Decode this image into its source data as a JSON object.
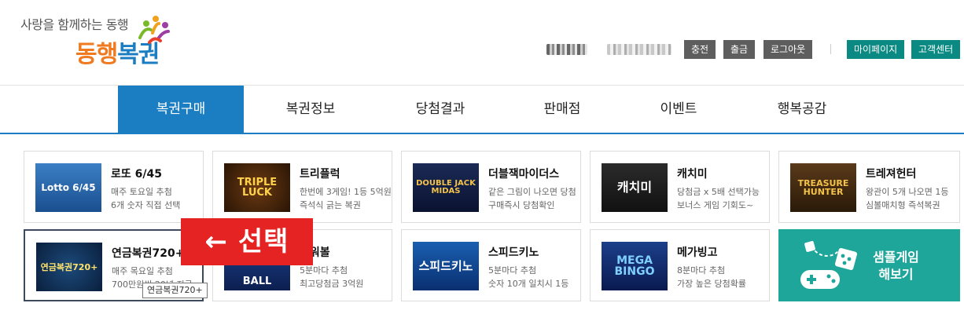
{
  "header": {
    "tagline": "사랑을 함께하는 동행",
    "logo_orange": "동행",
    "logo_blue": "복권",
    "buttons": {
      "charge": "충전",
      "withdraw": "출금",
      "logout": "로그아웃",
      "mypage": "마이페이지",
      "support": "고객센터"
    }
  },
  "nav": {
    "items": [
      "복권구매",
      "복권정보",
      "당첨결과",
      "판매점",
      "이벤트",
      "행복공감"
    ],
    "active_index": 0
  },
  "games": [
    {
      "title": "로또 6/45",
      "desc1": "매주 토요일 추첨",
      "desc2": "6개 숫자 직접 선택",
      "thumb_text": "Lotto 6/45"
    },
    {
      "title": "트리플럭",
      "desc1": "한번에 3게임! 1등 5억원",
      "desc2": "즉석식 긁는 복권",
      "thumb_text": "TRIPLE LUCK"
    },
    {
      "title": "더블잭마이더스",
      "desc1": "같은 그림이 나오면 당첨",
      "desc2": "구매즉시 당첨확인",
      "thumb_text": "DOUBLE JACK MIDAS"
    },
    {
      "title": "캐치미",
      "desc1": "당첨금 x 5배 선택가능",
      "desc2": "보너스 게임 기회도~",
      "thumb_text": "캐치미"
    },
    {
      "title": "트레져헌터",
      "desc1": "왕관이 5개 나오면 1등",
      "desc2": "심볼매치형 즉석복권",
      "thumb_text": "TREASURE HUNTER"
    },
    {
      "title": "연금복권720+",
      "desc1": "매주 목요일 추첨",
      "desc2": "700만원씩 20년 지급",
      "thumb_text": "연금복권720+"
    },
    {
      "title": "파워볼",
      "desc1": "5분마다 추첨",
      "desc2": "최고당첨금 3억원",
      "thumb_text": "BALL"
    },
    {
      "title": "스피드키노",
      "desc1": "5분마다 추첨",
      "desc2": "숫자 10개 일치시 1등",
      "thumb_text": "스피드키노"
    },
    {
      "title": "메가빙고",
      "desc1": "8분마다 추첨",
      "desc2": "가장 높은 당첨확률",
      "thumb_text": "MEGA BINGO"
    }
  ],
  "sample": {
    "line1": "샘플게임",
    "line2": "해보기"
  },
  "annotation": "← 선택",
  "tooltip": "연금복권720+",
  "colors": {
    "brand_blue": "#1b7ec2",
    "brand_orange": "#f07a1f",
    "teal": "#0a8a82",
    "sample_teal": "#1fa69a",
    "annotation_red": "#e52322"
  }
}
